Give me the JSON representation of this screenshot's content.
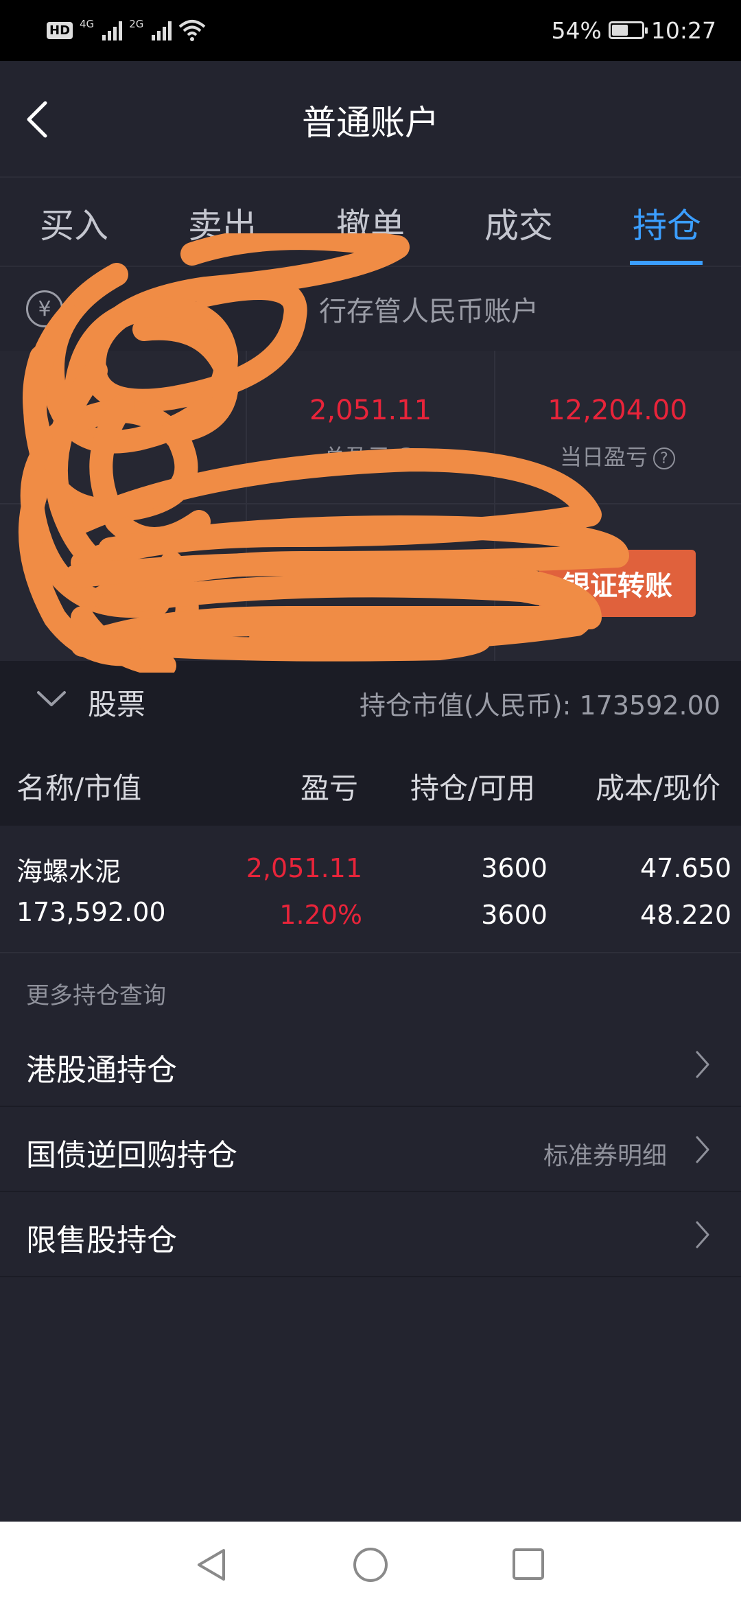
{
  "status_bar": {
    "hd": "HD",
    "sim1_network": "4G",
    "sim2_network": "2G",
    "battery_percent": "54%",
    "battery_level": 0.54,
    "time": "10:27"
  },
  "header": {
    "title": "普通账户",
    "back_icon": "chevron-left-icon"
  },
  "tabs": [
    {
      "label": "买入",
      "active": false
    },
    {
      "label": "卖出",
      "active": false
    },
    {
      "label": "撤单",
      "active": false
    },
    {
      "label": "成交",
      "active": false
    },
    {
      "label": "持仓",
      "active": true
    }
  ],
  "account": {
    "currency_icon": "¥",
    "name": "行存管人民币账户"
  },
  "stats": {
    "total_pl": {
      "value": "2,051.11",
      "label": "总盈亏",
      "help": "?"
    },
    "day_pl": {
      "value": "12,204.00",
      "label": "当日盈亏",
      "help": "?"
    },
    "transfer_button": "银证转账"
  },
  "stocks_section": {
    "title": "股票",
    "market_value_label": "持仓市值(人民币):",
    "market_value": "173592.00"
  },
  "table": {
    "headers": [
      "名称/市值",
      "盈亏",
      "持仓/可用",
      "成本/现价"
    ],
    "rows": [
      {
        "name": "海螺水泥",
        "market_value": "173,592.00",
        "pl": "2,051.11",
        "pl_pct": "1.20%",
        "position": "3600",
        "available": "3600",
        "cost": "47.650",
        "price": "48.220"
      }
    ]
  },
  "more": {
    "title": "更多持仓查询",
    "items": [
      {
        "label": "港股通持仓",
        "sub": ""
      },
      {
        "label": "国债逆回购持仓",
        "sub": "标准券明细"
      },
      {
        "label": "限售股持仓",
        "sub": ""
      }
    ]
  },
  "colors": {
    "accent": "#3b9eff",
    "loss_gain_red": "#e8243a",
    "button": "#e0613c",
    "background": "#23242f",
    "scribble": "#f08c45"
  }
}
